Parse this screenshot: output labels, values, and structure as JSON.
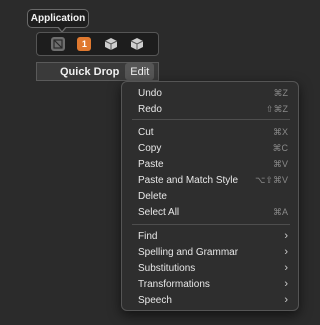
{
  "tooltip": {
    "text": "Application"
  },
  "iconbar": {
    "badge": "1",
    "icons": [
      "app-icon",
      "orange-badge-icon",
      "cube-icon",
      "cube-icon"
    ]
  },
  "quickdrop": {
    "label": "Quick Drop",
    "edit_label": "Edit"
  },
  "menu": {
    "undo": {
      "label": "Undo",
      "shortcut": "⌘Z"
    },
    "redo": {
      "label": "Redo",
      "shortcut": "⇧⌘Z"
    },
    "cut": {
      "label": "Cut",
      "shortcut": "⌘X"
    },
    "copy": {
      "label": "Copy",
      "shortcut": "⌘C"
    },
    "paste": {
      "label": "Paste",
      "shortcut": "⌘V"
    },
    "paste_style": {
      "label": "Paste and Match Style",
      "shortcut": "⌥⇧⌘V"
    },
    "delete": {
      "label": "Delete"
    },
    "select_all": {
      "label": "Select All",
      "shortcut": "⌘A"
    },
    "find": {
      "label": "Find"
    },
    "spelling": {
      "label": "Spelling and Grammar"
    },
    "substitutions": {
      "label": "Substitutions"
    },
    "transformations": {
      "label": "Transformations"
    },
    "speech": {
      "label": "Speech"
    },
    "chevron": "›"
  }
}
